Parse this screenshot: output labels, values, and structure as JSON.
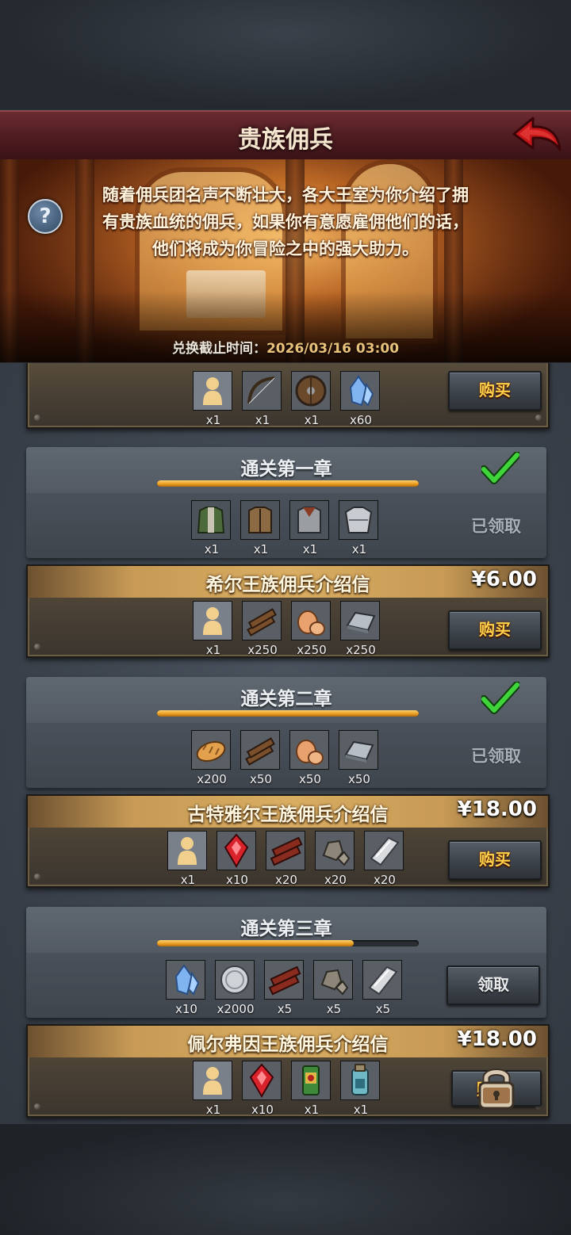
{
  "header": {
    "title": "贵族佣兵",
    "back_icon": "back-arrow-icon"
  },
  "banner": {
    "description_lines": [
      "随着佣兵团名声不断壮大，各大王室为你介绍了拥",
      "有贵族血统的佣兵，如果你有意愿雇佣他们的话，",
      "他们将成为你冒险之中的强大助力。"
    ],
    "deadline_label": "兑换截止时间：",
    "deadline_value": "2026/03/16 03:00",
    "help_icon": "?"
  },
  "packs": [
    {
      "id": "top-pack",
      "title": "",
      "price": "",
      "button": "购买",
      "items": [
        {
          "icon": "mercenary-silhouette-icon",
          "qty": "x1"
        },
        {
          "icon": "longbow-icon",
          "qty": "x1"
        },
        {
          "icon": "round-shield-icon",
          "qty": "x1"
        },
        {
          "icon": "blue-crystal-icon",
          "qty": "x60"
        }
      ]
    },
    {
      "id": "hill-pack",
      "title": "希尔王族佣兵介绍信",
      "price": "¥6.00",
      "button": "购买",
      "items": [
        {
          "icon": "mercenary-silhouette-icon",
          "qty": "x1"
        },
        {
          "icon": "wood-planks-icon",
          "qty": "x250"
        },
        {
          "icon": "clay-ore-icon",
          "qty": "x250"
        },
        {
          "icon": "iron-ingot-icon",
          "qty": "x250"
        }
      ]
    },
    {
      "id": "gutyar-pack",
      "title": "古特雅尔王族佣兵介绍信",
      "price": "¥18.00",
      "button": "购买",
      "items": [
        {
          "icon": "mercenary-silhouette-icon",
          "qty": "x1"
        },
        {
          "icon": "red-gem-icon",
          "qty": "x10"
        },
        {
          "icon": "timber-logs-icon",
          "qty": "x20"
        },
        {
          "icon": "stone-rubble-icon",
          "qty": "x20"
        },
        {
          "icon": "silver-bar-icon",
          "qty": "x20"
        }
      ]
    },
    {
      "id": "pelfin-pack",
      "title": "佩尔弗因王族佣兵介绍信",
      "price": "¥18.00",
      "button": "购",
      "locked": true,
      "items": [
        {
          "icon": "mercenary-silhouette-icon",
          "qty": "x1"
        },
        {
          "icon": "red-gem-icon",
          "qty": "x10"
        },
        {
          "icon": "green-scroll-icon",
          "qty": "x1"
        },
        {
          "icon": "potion-jar-icon",
          "qty": "x1"
        }
      ]
    }
  ],
  "chapters": [
    {
      "id": "chapter-1",
      "title": "通关第一章",
      "progress": 1.0,
      "status": "已领取",
      "completed": true,
      "items": [
        {
          "icon": "green-coat-armor-icon",
          "qty": "x1"
        },
        {
          "icon": "leather-vest-icon",
          "qty": "x1"
        },
        {
          "icon": "chainmail-icon",
          "qty": "x1"
        },
        {
          "icon": "plate-armor-icon",
          "qty": "x1"
        }
      ]
    },
    {
      "id": "chapter-2",
      "title": "通关第二章",
      "progress": 1.0,
      "status": "已领取",
      "completed": true,
      "items": [
        {
          "icon": "bread-icon",
          "qty": "x200"
        },
        {
          "icon": "wood-planks-icon",
          "qty": "x50"
        },
        {
          "icon": "clay-ore-icon",
          "qty": "x50"
        },
        {
          "icon": "iron-ingot-icon",
          "qty": "x50"
        }
      ]
    },
    {
      "id": "chapter-3",
      "title": "通关第三章",
      "progress": 0.75,
      "button": "领取",
      "completed": false,
      "items": [
        {
          "icon": "blue-crystal-icon",
          "qty": "x10"
        },
        {
          "icon": "silver-coin-icon",
          "qty": "x2000"
        },
        {
          "icon": "timber-logs-icon",
          "qty": "x5"
        },
        {
          "icon": "stone-rubble-icon",
          "qty": "x5"
        },
        {
          "icon": "silver-bar-icon",
          "qty": "x5"
        }
      ]
    }
  ],
  "colors": {
    "gold_text": "#ffd04a",
    "price_text": "#ffffff",
    "check_green": "#3fd43a",
    "progress_fill": "#e69a1e"
  }
}
